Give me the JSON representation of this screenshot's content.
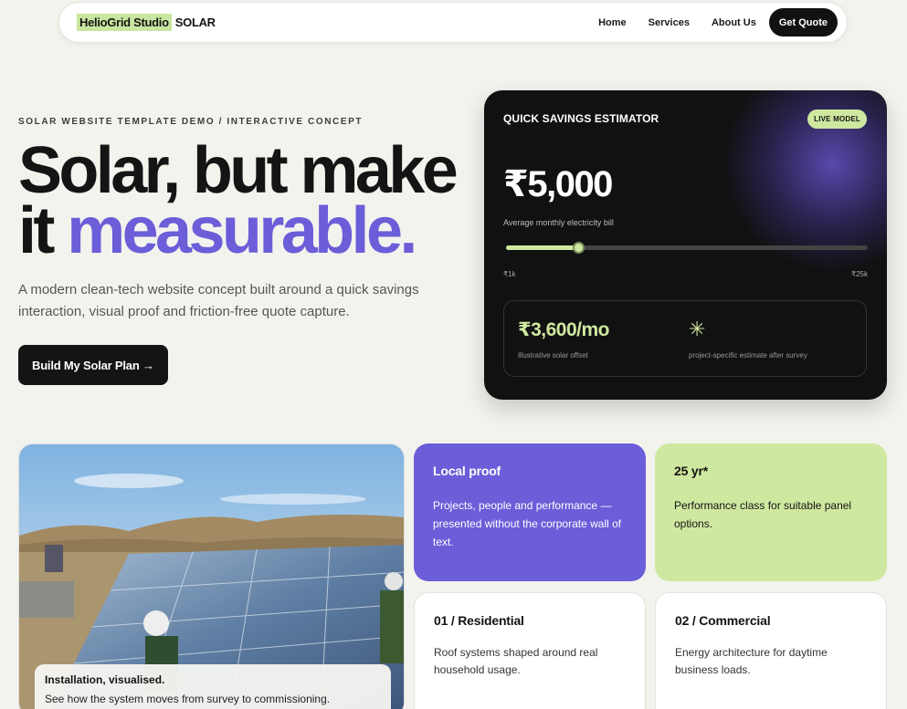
{
  "nav": {
    "brand_name": "HelioGrid Studio",
    "brand_suffix": "SOLAR",
    "links": [
      "Home",
      "Services",
      "About Us"
    ],
    "cta": "Get Quote"
  },
  "hero": {
    "eyebrow": "SOLAR WEBSITE TEMPLATE DEMO / INTERACTIVE CONCEPT",
    "headline_main": "Solar, but make it ",
    "headline_accent": "measurable.",
    "subtext": "A modern clean-tech website concept built around a quick savings interaction, visual proof and friction-free quote capture.",
    "button": "Build My Solar Plan →"
  },
  "estimator": {
    "title": "QUICK SAVINGS ESTIMATOR",
    "badge": "LIVE MODEL",
    "amount": "₹5,000",
    "amount_label": "Average monthly electricity bill",
    "slider": {
      "min_label": "₹1k",
      "max_label": "₹25k",
      "fill_fraction": 0.2
    },
    "result_value": "₹3,600/mo",
    "result_label": "illustrative solar offset",
    "result_star": "✳",
    "result_note": "project-specific estimate after survey"
  },
  "photo": {
    "caption_title": "Installation, visualised.",
    "caption_text": "See how the system moves from survey to commissioning."
  },
  "cards": [
    {
      "title": "Local proof",
      "text": "Projects, people and performance — presented without the corporate wall of text."
    },
    {
      "title": "25 yr*",
      "text": "Performance class for suitable panel options."
    },
    {
      "title": "01 / Residential",
      "text": "Roof systems shaped around real household usage."
    },
    {
      "title": "02 / Commercial",
      "text": "Energy architecture for daytime business loads."
    }
  ],
  "colors": {
    "accent_purple": "#6c5dd8",
    "accent_green": "#cfe8a0",
    "dark": "#111111",
    "background": "#f3f3ee"
  }
}
